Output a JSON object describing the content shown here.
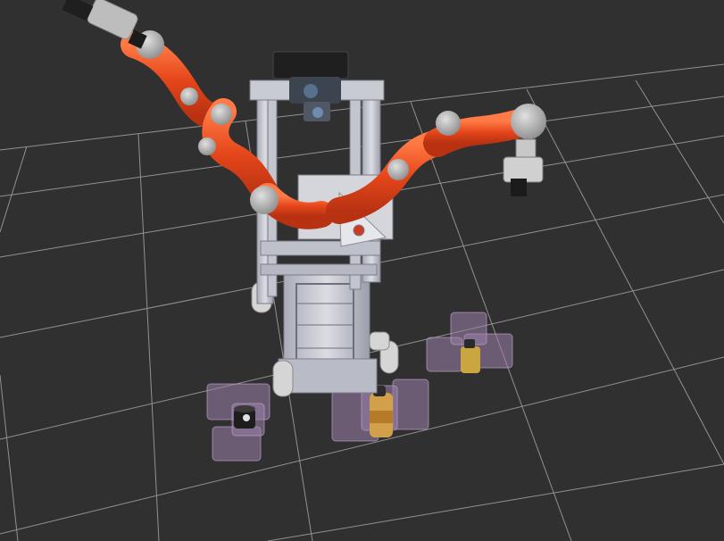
{
  "scene": {
    "view": "3d-robot-visualization",
    "background_color": "#303030",
    "grid_color": "#a0a0a0",
    "robot": {
      "frame_color": "#c8c8cc",
      "arm_color": "#e84a1c",
      "joint_color": "#a8a8a8",
      "sensor_head_color": "#1a1a1a",
      "wheel_color": "#d8d8d8"
    },
    "ghost_color": "#9a7fa8",
    "objects": [
      "ghost-gripper-left",
      "ghost-gripper-center",
      "ghost-gripper-right",
      "bottle-center",
      "bottle-right",
      "cup-left"
    ]
  }
}
